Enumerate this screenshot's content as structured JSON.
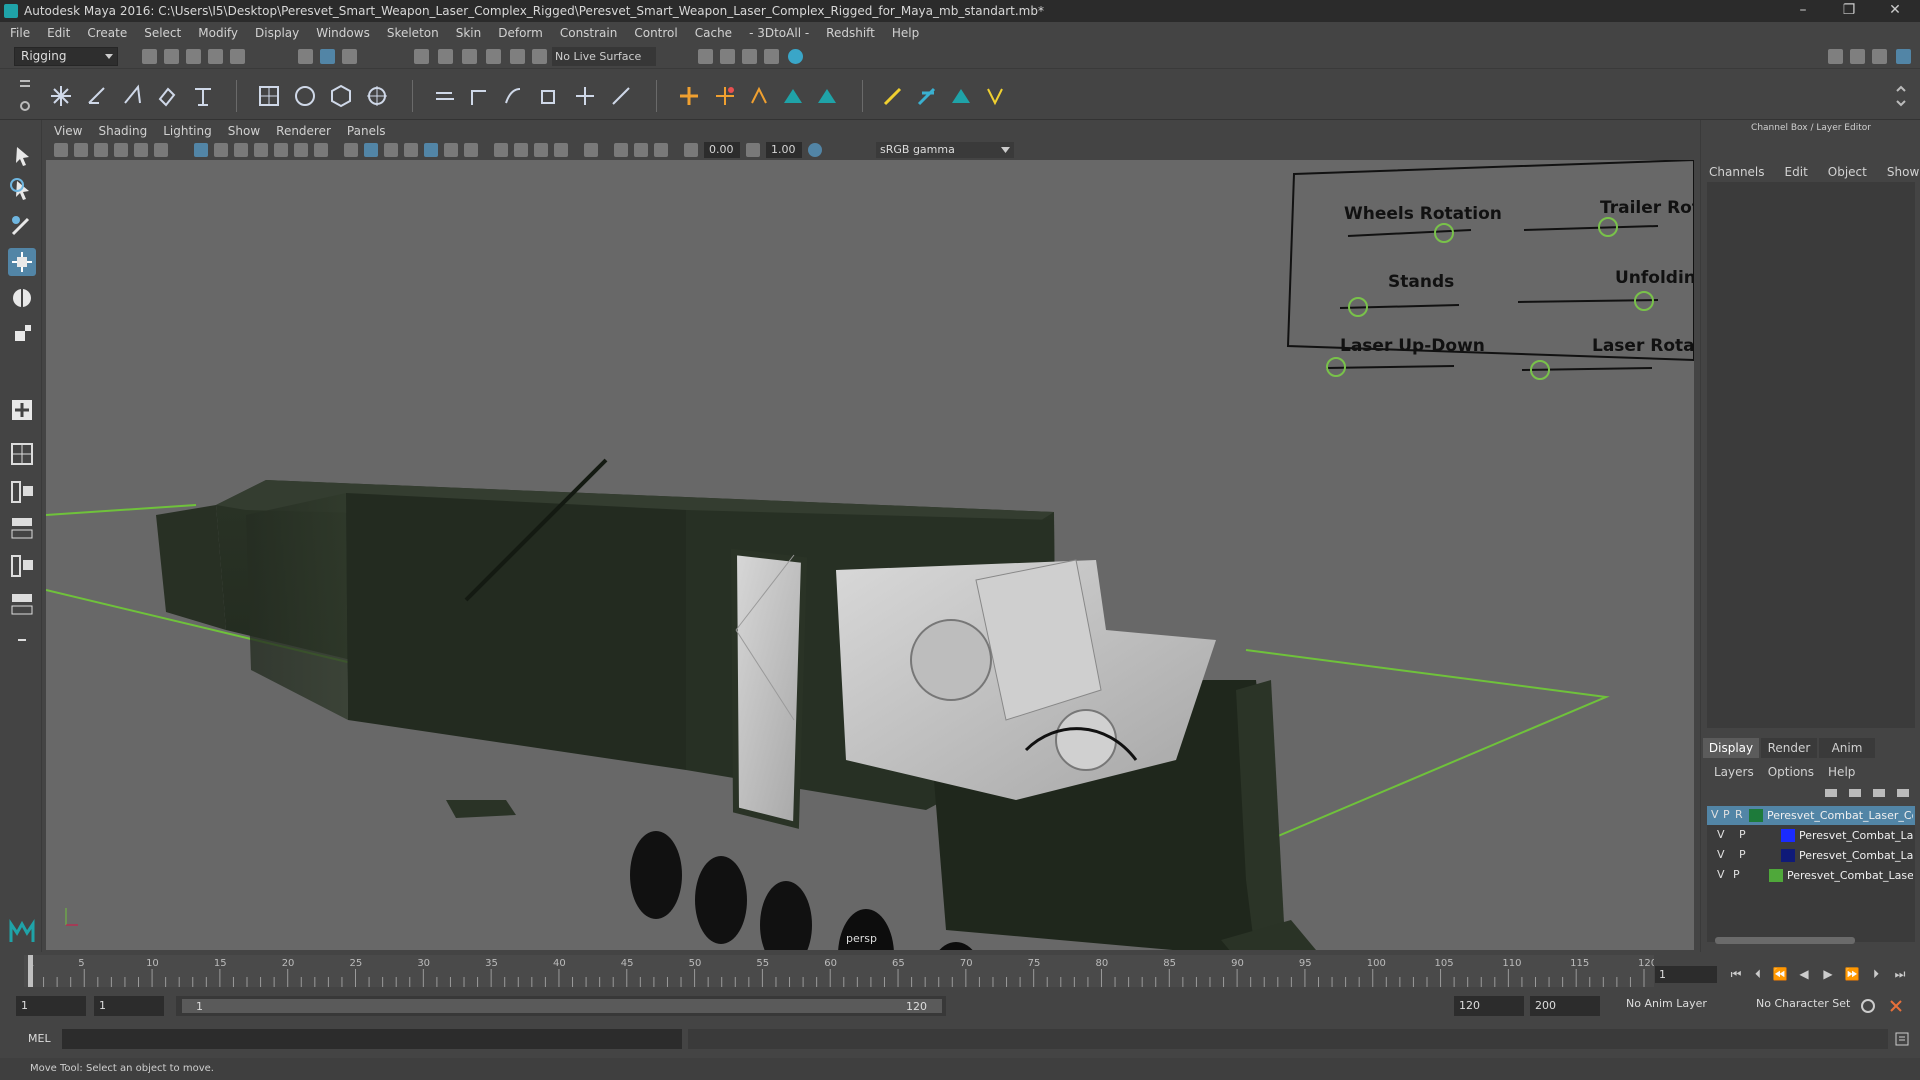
{
  "window": {
    "title": "Autodesk Maya 2016: C:\\Users\\I5\\Desktop\\Peresvet_Smart_Weapon_Laser_Complex_Rigged\\Peresvet_Smart_Weapon_Laser_Complex_Rigged_for_Maya_mb_standart.mb*",
    "minimize": "–",
    "restore": "❐",
    "close": "✕"
  },
  "menu": [
    "File",
    "Edit",
    "Create",
    "Select",
    "Modify",
    "Display",
    "Windows",
    "Skeleton",
    "Skin",
    "Deform",
    "Constrain",
    "Control",
    "Cache",
    "- 3DtoAll -",
    "Redshift",
    "Help"
  ],
  "status": {
    "mode": "Rigging",
    "live_surface": "No Live Surface"
  },
  "panel": {
    "menu": [
      "View",
      "Shading",
      "Lighting",
      "Show",
      "Renderer",
      "Panels"
    ],
    "near_value": "0.00",
    "far_value": "1.00",
    "color_space": "sRGB gamma",
    "camera_label": "persp"
  },
  "controls": [
    {
      "label": "Wheels Rotation"
    },
    {
      "label": "Trailer Rotation"
    },
    {
      "label": "Stands"
    },
    {
      "label": "Unfolding"
    },
    {
      "label": "Laser Up-Down"
    },
    {
      "label": "Laser Rotation"
    }
  ],
  "right_panel": {
    "title": "Channel Box / Layer Editor",
    "menu": [
      "Channels",
      "Edit",
      "Object",
      "Show"
    ],
    "tabs": [
      "Display",
      "Render",
      "Anim"
    ],
    "active_tab": "Display",
    "layer_menu": [
      "Layers",
      "Options",
      "Help"
    ],
    "layers": [
      {
        "v": "V",
        "p": "P",
        "r": "R",
        "color": "#1d7a3a",
        "name": "Peresvet_Combat_Laser_Com",
        "selected": true
      },
      {
        "v": "V",
        "p": "P",
        "r": "",
        "color": "#1a2bff",
        "name": "Peresvet_Combat_Lase",
        "selected": false
      },
      {
        "v": "V",
        "p": "P",
        "r": "",
        "color": "#0f1a78",
        "name": "Peresvet_Combat_Lase",
        "selected": false
      },
      {
        "v": "V",
        "p": "P",
        "r": "",
        "color": "#4fa83a",
        "name": "Peresvet_Combat_Laser_C",
        "selected": false
      }
    ]
  },
  "timeline": {
    "ticks": [
      "1",
      "5",
      "10",
      "15",
      "20",
      "25",
      "30",
      "35",
      "40",
      "45",
      "50",
      "55",
      "60",
      "65",
      "70",
      "75",
      "80",
      "85",
      "90",
      "95",
      "100",
      "105",
      "110",
      "115",
      "120"
    ],
    "current_frame": "1"
  },
  "range": {
    "start": "1",
    "playback_start": "1",
    "slider_start": "1",
    "slider_end": "120",
    "playback_end": "120",
    "end": "200",
    "anim_layer": "No Anim Layer",
    "character_set": "No Character Set"
  },
  "command": {
    "lang": "MEL"
  },
  "help_line": "Move Tool: Select an object to move."
}
